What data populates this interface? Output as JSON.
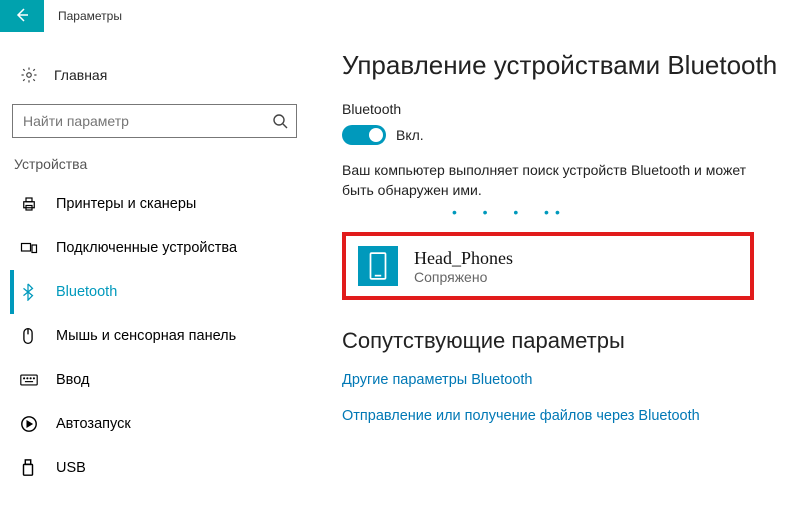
{
  "titlebar": {
    "title": "Параметры"
  },
  "sidebar": {
    "home": "Главная",
    "search_placeholder": "Найти параметр",
    "group": "Устройства",
    "items": [
      {
        "label": "Принтеры и сканеры"
      },
      {
        "label": "Подключенные устройства"
      },
      {
        "label": "Bluetooth"
      },
      {
        "label": "Мышь и сенсорная панель"
      },
      {
        "label": "Ввод"
      },
      {
        "label": "Автозапуск"
      },
      {
        "label": "USB"
      }
    ]
  },
  "main": {
    "heading": "Управление устройствами Bluetooth",
    "bt_label": "Bluetooth",
    "toggle_state": "Вкл.",
    "description": "Ваш компьютер выполняет поиск устройств Bluetooth и может быть обнаружен ими.",
    "device": {
      "name": "Head_Phones",
      "status": "Сопряжено"
    },
    "related_heading": "Сопутствующие параметры",
    "link1": "Другие параметры Bluetooth",
    "link2": "Отправление или получение файлов через Bluetooth"
  },
  "colors": {
    "accent": "#0099bc",
    "highlight": "#e11b1b"
  }
}
